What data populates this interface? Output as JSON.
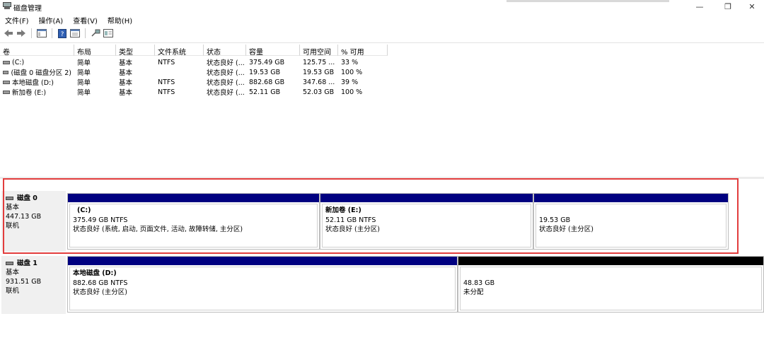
{
  "window": {
    "title": "磁盘管理",
    "minimize_glyph": "—",
    "restore_glyph": "❐",
    "close_glyph": "✕"
  },
  "menu": [
    "文件(F)",
    "操作(A)",
    "查看(V)",
    "帮助(H)"
  ],
  "toolbar": {
    "icons": [
      "back-arrow-icon",
      "forward-arrow-icon",
      "console-tree-icon",
      "help-icon",
      "properties-icon",
      "connect-icon",
      "list-view-icon"
    ]
  },
  "columns": [
    "卷",
    "布局",
    "类型",
    "文件系统",
    "状态",
    "容量",
    "可用空间",
    "% 可用"
  ],
  "volumes": [
    {
      "name": "(C:)",
      "layout": "简单",
      "type": "基本",
      "fs": "NTFS",
      "status": "状态良好 (...",
      "capacity": "375.49 GB",
      "free": "125.75 ...",
      "pct": "33 %"
    },
    {
      "name": "(磁盘 0 磁盘分区 2)",
      "layout": "简单",
      "type": "基本",
      "fs": "",
      "status": "状态良好 (...",
      "capacity": "19.53 GB",
      "free": "19.53 GB",
      "pct": "100 %"
    },
    {
      "name": "本地磁盘 (D:)",
      "layout": "简单",
      "type": "基本",
      "fs": "NTFS",
      "status": "状态良好 (...",
      "capacity": "882.68 GB",
      "free": "347.68 ...",
      "pct": "39 %"
    },
    {
      "name": "新加卷 (E:)",
      "layout": "简单",
      "type": "基本",
      "fs": "NTFS",
      "status": "状态良好 (...",
      "capacity": "52.11 GB",
      "free": "52.03 GB",
      "pct": "100 %"
    }
  ],
  "disks": [
    {
      "name": "磁盘 0",
      "type": "基本",
      "size": "447.13 GB",
      "state": "联机",
      "partitions": [
        {
          "title": "(C:)",
          "detail": "375.49 GB NTFS",
          "status": "状态良好 (系统, 启动, 页面文件, 活动, 故障转储, 主分区)"
        },
        {
          "title": "新加卷  (E:)",
          "detail": "52.11 GB NTFS",
          "status": "状态良好 (主分区)"
        },
        {
          "title": "",
          "detail": "19.53 GB",
          "status": "状态良好 (主分区)"
        }
      ]
    },
    {
      "name": "磁盘 1",
      "type": "基本",
      "size": "931.51 GB",
      "state": "联机",
      "partitions": [
        {
          "title": "本地磁盘  (D:)",
          "detail": "882.68 GB NTFS",
          "status": "状态良好 (主分区)"
        },
        {
          "title": "",
          "detail": "48.83 GB",
          "status": "未分配"
        }
      ]
    }
  ],
  "colors": {
    "primary_partition_bar": "#000080",
    "unallocated_bar": "#000000",
    "highlight_box": "#e23d3d"
  }
}
